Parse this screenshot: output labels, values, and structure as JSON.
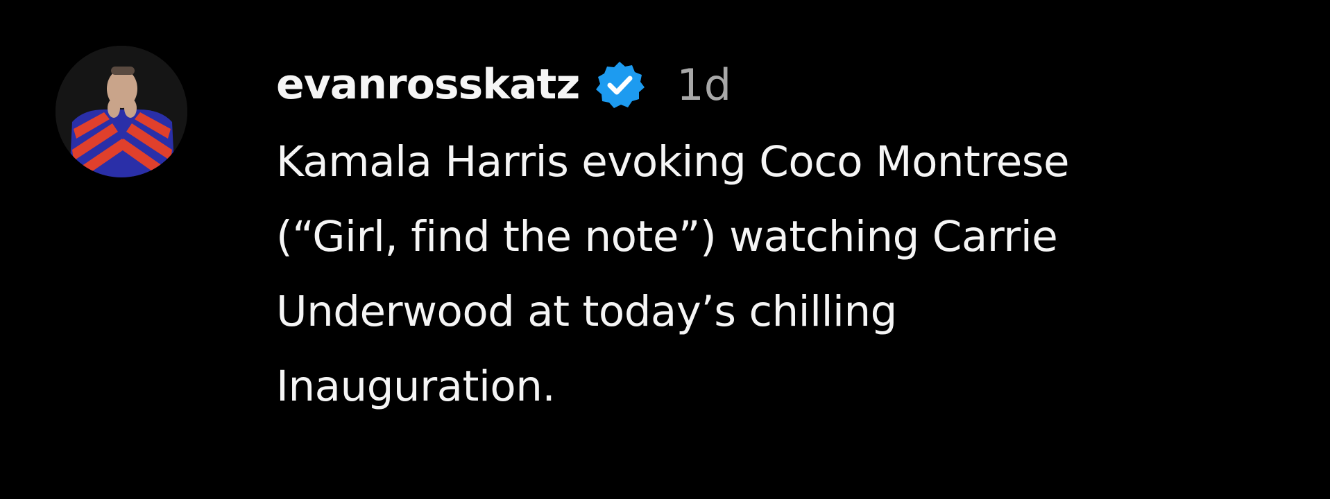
{
  "post": {
    "author": {
      "username": "evanrosskatz",
      "verified": true,
      "avatar_icon": "profile-photo-avatar"
    },
    "timestamp": "1d",
    "caption_lines": [
      "Kamala Harris evoking Coco Montrese",
      "(“Girl, find the note”) watching Carrie",
      "Underwood at today’s chilling",
      "Inauguration."
    ]
  },
  "colors": {
    "background": "#000000",
    "text": "#f5f5f5",
    "muted": "#a8a8a8",
    "verified_blue": "#1d9bf0"
  }
}
